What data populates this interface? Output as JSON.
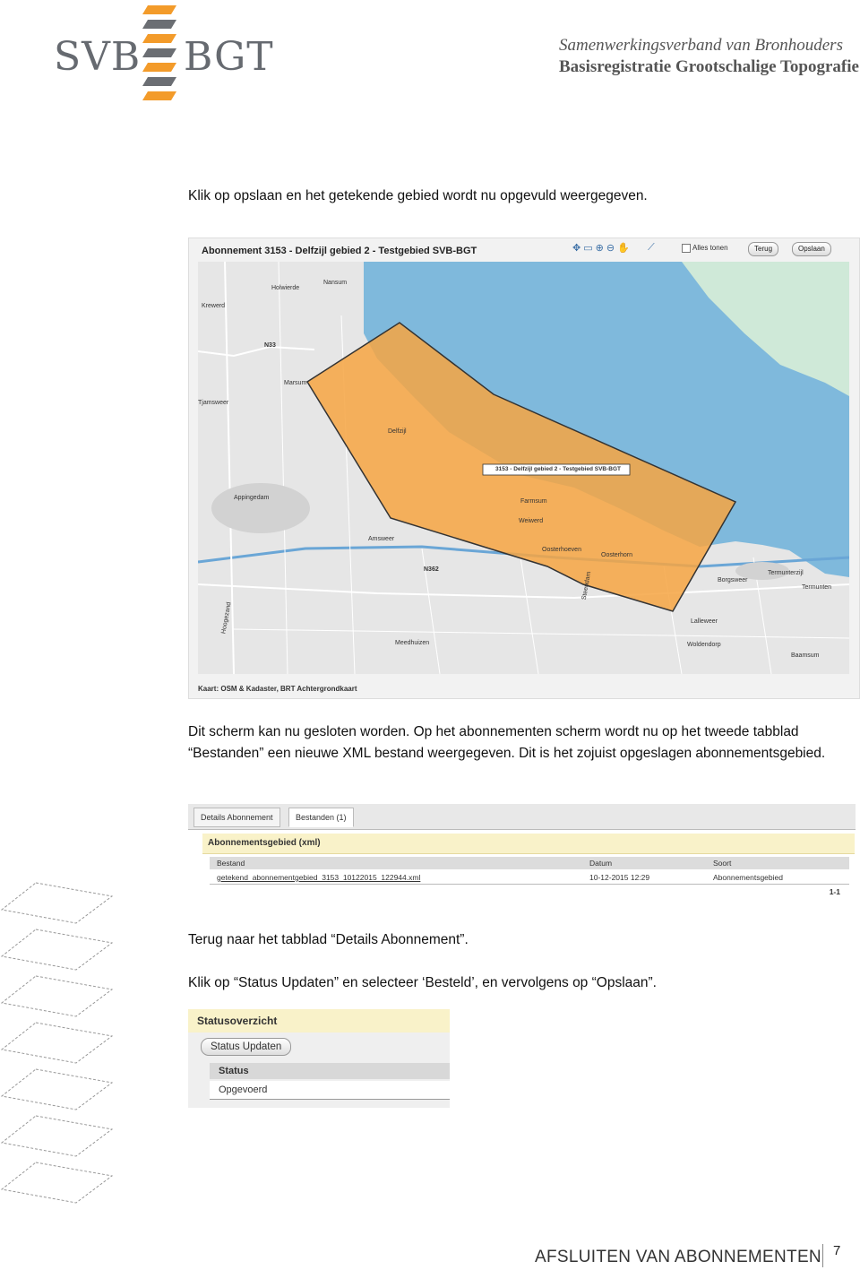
{
  "header": {
    "logo_left": "SVB",
    "logo_right": "BGT",
    "org_line1": "Samenwerkingsverband van Bronhouders",
    "org_line2": "Basisregistratie Grootschalige Topografie"
  },
  "body": {
    "p1": "Klik op opslaan en het getekende gebied wordt nu opgevuld weergegeven.",
    "p2": "Dit scherm kan nu gesloten worden. Op het abonnementen scherm wordt nu op het tweede tabblad “Bestanden” een nieuwe XML bestand weergegeven. Dit is het zojuist opgeslagen abonnementsgebied.",
    "p3": "Terug naar het tabblad “Details Abonnement”.",
    "p4": "Klik op “Status Updaten” en selecteer ‘Besteld’, en vervolgens op “Opslaan”."
  },
  "map": {
    "title": "Abonnement 3153 - Delfzijl gebied 2 - Testgebied SVB-BGT",
    "show_all_label": "Alles tonen",
    "back_button": "Terug",
    "save_button": "Opslaan",
    "area_label": "3153 - Delfzijl gebied 2 - Testgebied SVB-BGT",
    "credit": "Kaart: OSM & Kadaster, BRT Achtergrondkaart",
    "place_names": [
      "Holwierde",
      "Nansum",
      "Krewerd",
      "Marsum",
      "Appingedam",
      "Delfzijl",
      "Farmsum",
      "Weiwerd",
      "Oosterhoeven",
      "Oosterhorn",
      "Amsweer",
      "Borgsweer",
      "Termunterzijl",
      "Termunten",
      "Lalleweer",
      "Woldendorp",
      "Meedhuizen",
      "Hoogezand",
      "N33",
      "N362",
      "Tjamsweer",
      "Steendam",
      "Baamsum"
    ],
    "colors": {
      "water": "#7fb9dc",
      "land": "#e4e4e4",
      "area_fill": "#f6a442",
      "area_stroke": "#333333"
    }
  },
  "bestanden": {
    "tab_details": "Details Abonnement",
    "tab_files": "Bestanden (1)",
    "panel_title": "Abonnementsgebied (xml)",
    "columns": [
      "Bestand",
      "Datum",
      "Soort"
    ],
    "rows": [
      {
        "bestand": "getekend_abonnementgebied_3153_10122015_122944.xml",
        "datum": "10-12-2015 12:29",
        "soort": "Abonnementsgebied"
      }
    ],
    "pager": "1-1"
  },
  "status": {
    "title": "Statusoverzicht",
    "button": "Status Updaten",
    "column": "Status",
    "value": "Opgevoerd"
  },
  "footer": {
    "title": "AFSLUITEN VAN ABONNEMENTEN",
    "page": "7"
  }
}
